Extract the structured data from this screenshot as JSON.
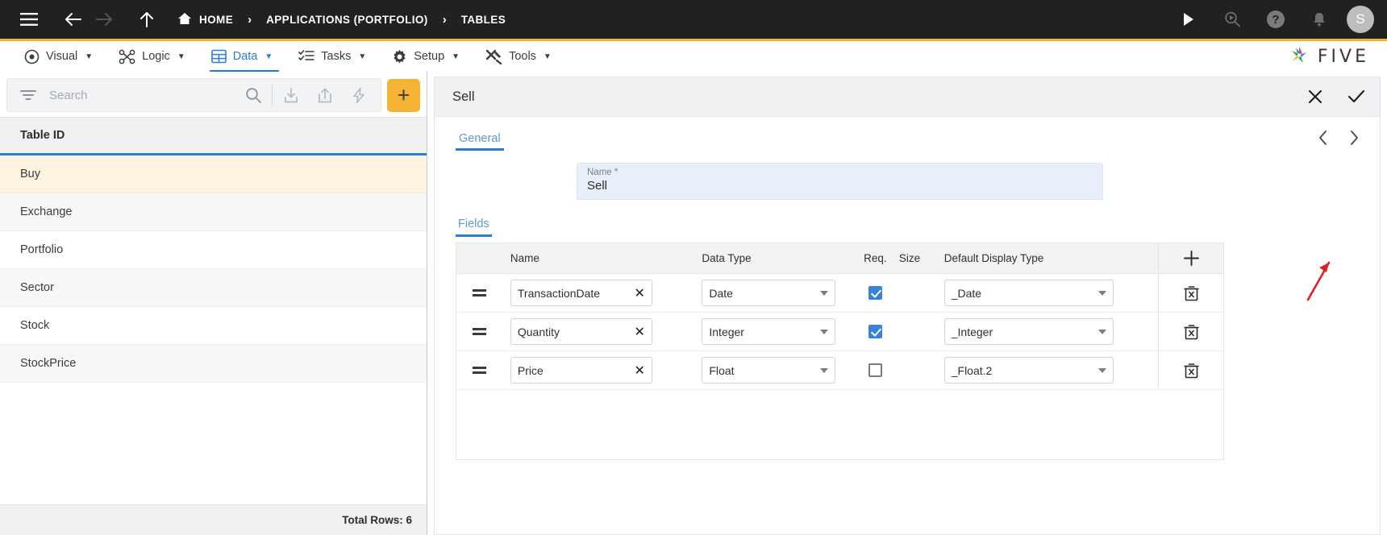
{
  "topbar": {
    "menu_icon": "hamburger-icon",
    "back_icon": "arrow-left-icon",
    "forward_icon": "arrow-right-icon",
    "up_icon": "arrow-up-icon",
    "home_label": "HOME",
    "separator": "›",
    "breadcrumbs": [
      "APPLICATIONS (PORTFOLIO)",
      "TABLES"
    ],
    "run_icon": "play-icon",
    "search_icon": "search-play-icon",
    "help_icon": "help-icon",
    "help_glyph": "?",
    "notifications_icon": "bell-icon",
    "avatar_letter": "S",
    "bg_color": "#212121"
  },
  "menubar": {
    "accent_color": "#f5b433",
    "active_color": "#2a7fd4",
    "items": [
      {
        "label": "Visual",
        "icon": "eye-icon",
        "caret": "▼",
        "active": false
      },
      {
        "label": "Logic",
        "icon": "logic-nodes-icon",
        "caret": "▼",
        "active": false
      },
      {
        "label": "Data",
        "icon": "table-grid-icon",
        "caret": "▼",
        "active": true
      },
      {
        "label": "Tasks",
        "icon": "task-list-icon",
        "caret": "▼",
        "active": false
      },
      {
        "label": "Setup",
        "icon": "gear-icon",
        "caret": "▼",
        "active": false
      },
      {
        "label": "Tools",
        "icon": "tools-icon",
        "caret": "▼",
        "active": false
      }
    ],
    "brand": "FIVE"
  },
  "sidebar": {
    "search": {
      "placeholder": "Search",
      "value": ""
    },
    "filter_icon": "filter-icon",
    "search_icon": "magnifier-icon",
    "import_icon": "download-icon",
    "export_icon": "upload-share-icon",
    "quick_icon": "lightning-icon",
    "add_label": "+",
    "column_header": "Table ID",
    "rows": [
      {
        "label": "Buy",
        "selected": true
      },
      {
        "label": "Exchange",
        "selected": false
      },
      {
        "label": "Portfolio",
        "selected": false
      },
      {
        "label": "Sector",
        "selected": false
      },
      {
        "label": "Stock",
        "selected": false
      },
      {
        "label": "StockPrice",
        "selected": false
      }
    ],
    "footer": "Total Rows: 6",
    "selected_bg": "#fdf3de"
  },
  "detail": {
    "title": "Sell",
    "close_icon": "close-icon",
    "confirm_icon": "check-icon",
    "prev_icon": "chevron-left-icon",
    "next_icon": "chevron-right-icon",
    "tabs": [
      {
        "label": "General",
        "active": true
      }
    ],
    "name_field": {
      "label": "Name *",
      "value": "Sell"
    },
    "fields_tabs": [
      {
        "label": "Fields",
        "active": true
      }
    ],
    "grid": {
      "columns": [
        "",
        "Name",
        "Data Type",
        "Req.",
        "Size",
        "Default Display Type",
        ""
      ],
      "add_row_label": "+",
      "delete_icon": "trash-icon",
      "rows": [
        {
          "handle": "drag-handle",
          "name": "TransactionDate",
          "clear": "✕",
          "data_type": "Date",
          "required": true,
          "size": "",
          "default_display_type": "_Date"
        },
        {
          "handle": "drag-handle",
          "name": "Quantity",
          "clear": "✕",
          "data_type": "Integer",
          "required": true,
          "size": "",
          "default_display_type": "_Integer"
        },
        {
          "handle": "drag-handle",
          "name": "Price",
          "clear": "✕",
          "data_type": "Float",
          "required": false,
          "size": "",
          "default_display_type": "_Float.2"
        }
      ]
    }
  },
  "annotation": {
    "arrow_color": "#e02020",
    "target": "add-field-row-button"
  }
}
